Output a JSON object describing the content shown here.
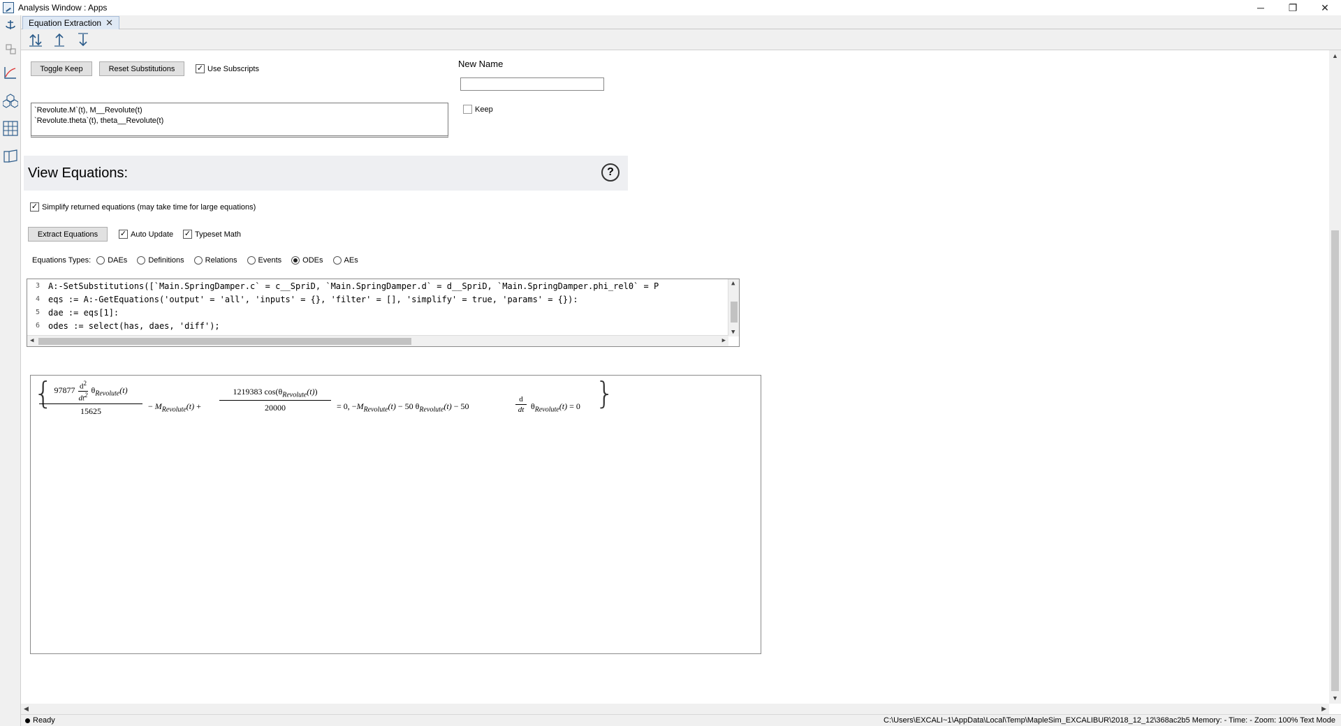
{
  "window": {
    "title": "Analysis Window : Apps",
    "minimize": "─",
    "maximize": "❐",
    "close": "✕"
  },
  "tab": {
    "label": "Equation Extraction",
    "close": "✕"
  },
  "toolbar": {
    "icons": [
      "swap-up-down-icon",
      "arrow-up-icon",
      "arrow-down-icon"
    ]
  },
  "sidebar": {
    "icons": [
      "anchor-icon",
      "component-icon",
      "plot-icon",
      "cubes-icon",
      "grid-icon",
      "book-icon"
    ]
  },
  "substitutions": {
    "toggle_keep": "Toggle Keep",
    "reset": "Reset Substitutions",
    "use_subscripts": "Use Subscripts",
    "new_name_label": "New Name",
    "new_name_value": "",
    "keep_label": "Keep",
    "list": [
      "`Revolute.M`(t),   M__Revolute(t)",
      "`Revolute.theta`(t),   theta__Revolute(t)"
    ]
  },
  "view_equations": {
    "title": "View Equations:",
    "help": "?",
    "simplify_label": "Simplify returned equations (may take time for large equations)",
    "extract_button": "Extract Equations",
    "auto_update": "Auto Update",
    "typeset_math": "Typeset Math",
    "types_label": "Equations Types:",
    "types": [
      "DAEs",
      "Definitions",
      "Relations",
      "Events",
      "ODEs",
      "AEs"
    ],
    "selected_type": "ODEs"
  },
  "code": {
    "lines": [
      {
        "n": "3",
        "text": "A:-SetSubstitutions([`Main.SpringDamper.c` = c__SpriD, `Main.SpringDamper.d` = d__SpriD, `Main.SpringDamper.phi_rel0` = P"
      },
      {
        "n": "4",
        "text": "eqs := A:-GetEquations('output' = 'all', 'inputs' = {}, 'filter' = [], 'simplify' = true, 'params' = {}):"
      },
      {
        "n": "5",
        "text": "dae := eqs[1]:"
      },
      {
        "n": "6",
        "text": "odes := select(has, daes, 'diff');"
      }
    ]
  },
  "math": {
    "n1": "97877",
    "d1": "15625",
    "n2": "1219383 cos",
    "d2": "20000",
    "theta": "θ",
    "sub_rev": "Revolute",
    "t": "(t)",
    "M": "M",
    "minus": "−",
    "plus": "+",
    "eq0c": "= 0,",
    "eq0": "= 0",
    "fifty": "50",
    "d": "d",
    "dt": "dt",
    "d2sym": "d",
    "dt2sym": "dt"
  },
  "status": {
    "left": "Ready",
    "right": "C:\\Users\\EXCALI~1\\AppData\\Local\\Temp\\MapleSim_EXCALIBUR\\2018_12_12\\368ac2b5   Memory: -   Time: -   Zoom: 100%   Text Mode"
  }
}
